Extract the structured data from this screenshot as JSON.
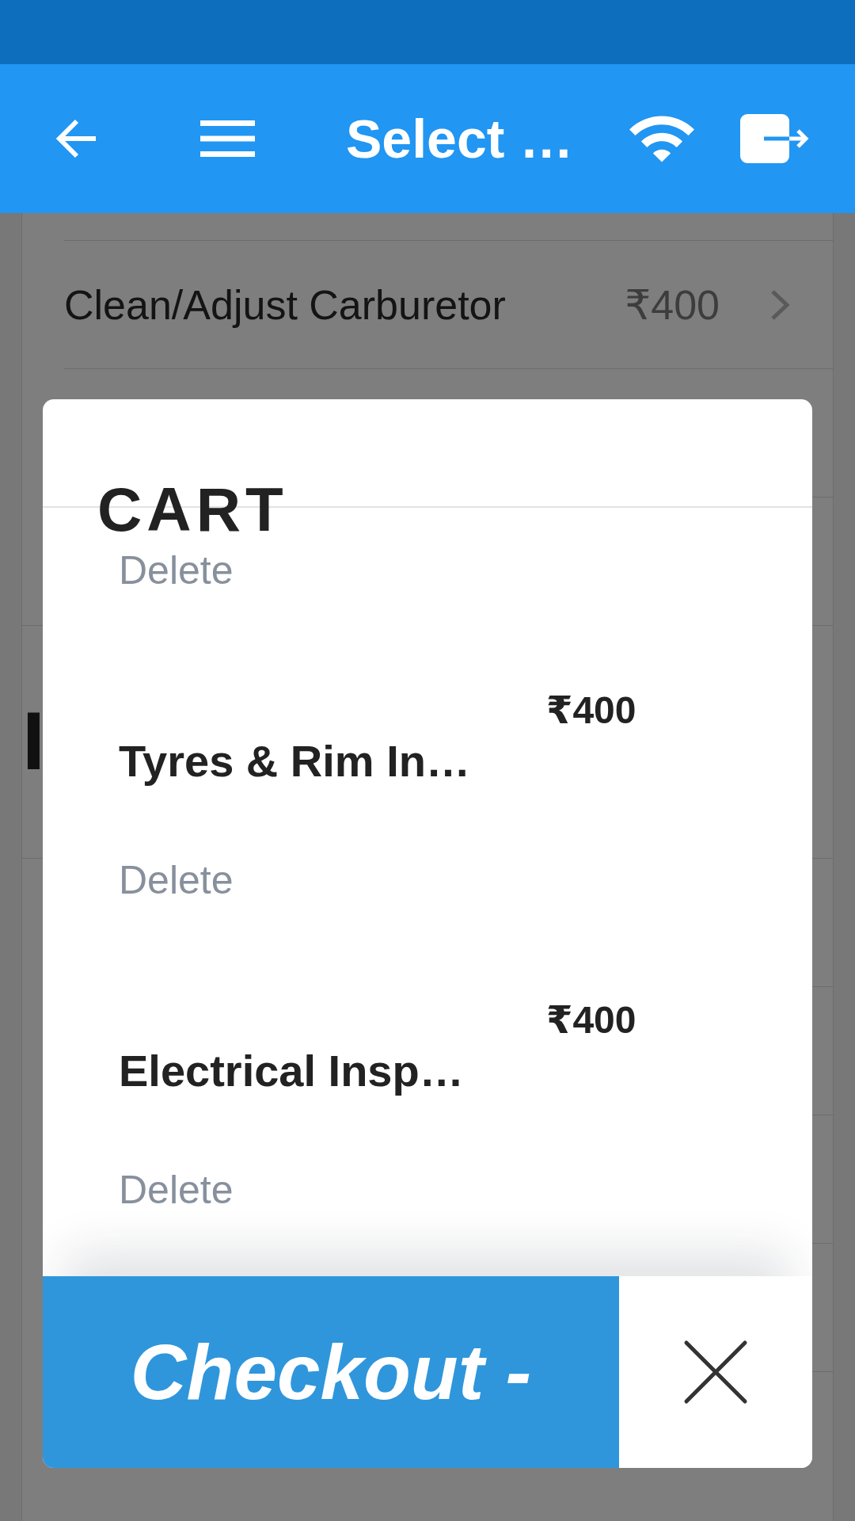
{
  "app_bar": {
    "title": "Select …"
  },
  "service_list": {
    "rows": [
      {
        "name": "Clean/Adjust Carburetor",
        "price": "₹400"
      }
    ],
    "section_heading": "I"
  },
  "cart": {
    "title": "CART",
    "items": [
      {
        "delete": "Delete"
      },
      {
        "name": "Tyres & Rim In…",
        "price": "₹400",
        "delete": "Delete"
      },
      {
        "name": "Electrical Insp…",
        "price": "₹400",
        "delete": "Delete"
      }
    ],
    "checkout_button": "Checkout -"
  }
}
